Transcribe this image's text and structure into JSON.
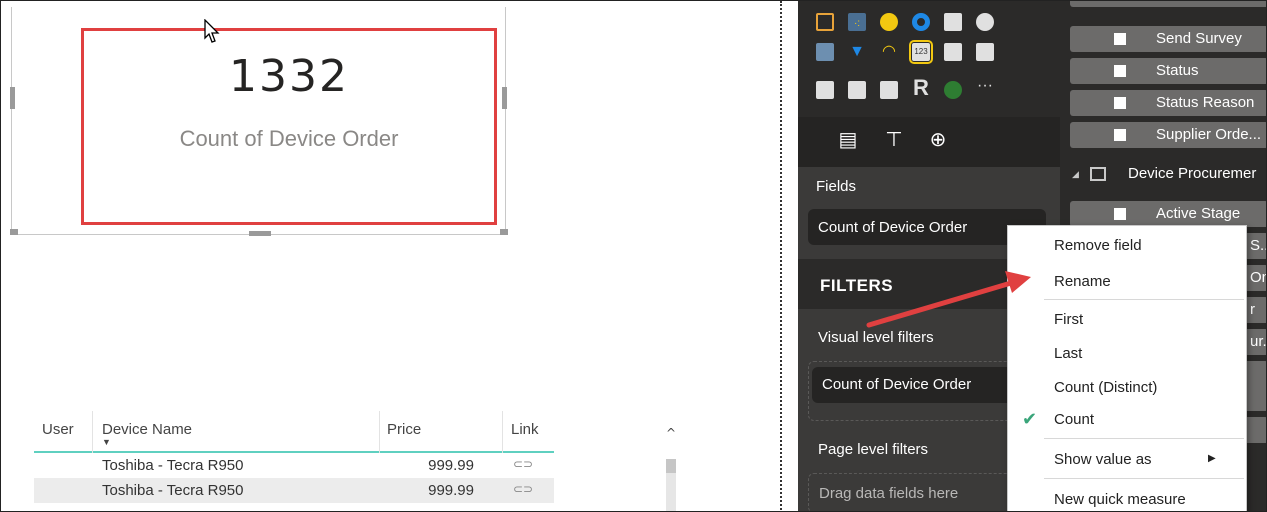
{
  "card": {
    "value": "1332",
    "label": "Count of Device Order"
  },
  "table": {
    "headers": [
      "User",
      "Device Name",
      "Price",
      "Link"
    ],
    "rows": [
      {
        "user": "",
        "device": "Toshiba - Tecra R950",
        "price": "999.99",
        "link_icon": "link-icon"
      },
      {
        "user": "",
        "device": "Toshiba - Tecra R950",
        "price": "999.99",
        "link_icon": "link-icon"
      }
    ]
  },
  "viz_pane": {
    "fields_label": "Fields",
    "field_well_value": "Count of Device Order",
    "filters_title": "FILTERS",
    "visual_level_filters": "Visual level filters",
    "visual_filter_chip": "Count of Device Order",
    "page_level_filters": "Page level filters",
    "drag_placeholder": "Drag data fields here",
    "gallery_more": "···",
    "gallery_r": "R"
  },
  "fields_list": {
    "top_items": [
      "Send Survey",
      "Status",
      "Status Reason",
      "Supplier Orde..."
    ],
    "table_name": "Device Procuremer",
    "table_items": [
      "Active Stage"
    ],
    "partial_items": [
      "S..",
      "Ona",
      "r",
      "ur.."
    ]
  },
  "context_menu": {
    "items": [
      {
        "label": "Remove field"
      },
      {
        "label": "Rename"
      },
      {
        "label": "First"
      },
      {
        "label": "Last"
      },
      {
        "label": "Count (Distinct)"
      },
      {
        "label": "Count",
        "checked": true
      },
      {
        "label": "Show value as",
        "submenu": true
      },
      {
        "label": "New quick measure"
      }
    ]
  },
  "colors": {
    "highlight": "#e04040",
    "pane_dark": "#3b3a39",
    "accent_yellow": "#f2c811",
    "check_green": "#3aa57a",
    "table_rule": "#5fd0c0"
  }
}
